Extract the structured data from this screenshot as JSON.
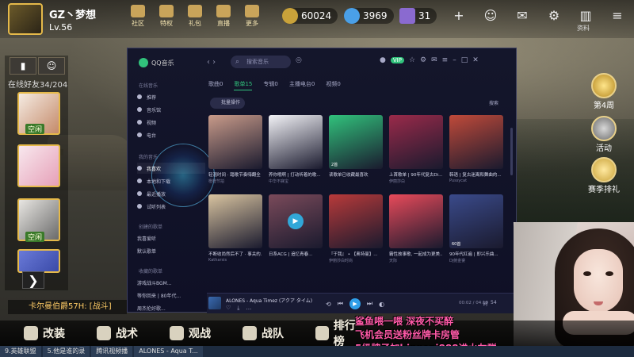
{
  "game": {
    "player_name": "GZ丶梦想",
    "player_level": "Lv.56",
    "top_nav": [
      {
        "label": "社区",
        "icon": "home-icon"
      },
      {
        "label": "特权",
        "icon": "crown-icon"
      },
      {
        "label": "礼包",
        "icon": "gift-icon"
      },
      {
        "label": "直播",
        "icon": "play-icon"
      },
      {
        "label": "更多",
        "icon": "grid-icon"
      }
    ],
    "currency": {
      "gold": "60024",
      "diamond": "3969",
      "card": "31"
    },
    "top_right_label": "资料",
    "friends": {
      "online_count": "在线好友34/204",
      "status_label": "空闲",
      "status_label_3": "空闲"
    },
    "chat_line": "卡尔曼伯爵57H: [战斗]",
    "bottom_menu": [
      {
        "label": "改装",
        "icon": "wrench-icon"
      },
      {
        "label": "战术",
        "icon": "skull-icon"
      },
      {
        "label": "观战",
        "icon": "star-icon"
      },
      {
        "label": "战队",
        "icon": "team-icon"
      },
      {
        "label": "排行榜",
        "icon": "trophy-icon"
      }
    ],
    "events": [
      {
        "label": "第4周"
      },
      {
        "label": "活动"
      },
      {
        "label": "赛季排礼"
      }
    ]
  },
  "overlay_chat": [
    "鲨鱼喂一喂  深夜不买醉",
    "飞机会员送粉丝牌卡房管",
    "5级牌子加biggezi888进水友群"
  ],
  "taskbar": [
    {
      "label": "9.英雄联盟"
    },
    {
      "label": "5.他是谁的录"
    },
    {
      "label": "腾讯视频播"
    },
    {
      "label": "ALONES - Aqua T..."
    }
  ],
  "qq_music": {
    "app_name": "QQ音乐",
    "search_placeholder": "搜索音乐",
    "sidebar": {
      "sections": [
        "在线音乐",
        "我的音乐",
        "创建的歌单",
        "收藏的歌单"
      ],
      "online": [
        "推荐",
        "音乐馆",
        "视频",
        "电台"
      ],
      "mine": [
        "我喜欢",
        "本地和下载",
        "最近播放",
        "试听列表"
      ],
      "created": [
        "我喜爱听",
        "默认歌单"
      ],
      "collected": [
        "游戏战斗BGM...",
        "等你回来 | 80年代...",
        "周杰伦好歌..."
      ]
    },
    "tabs": [
      "歌曲0",
      "歌单15",
      "专辑0",
      "主播电台0",
      "视频0"
    ],
    "active_tab_index": 1,
    "batch_button": "批量操作",
    "search_button": "搜索",
    "cards": [
      {
        "title": "轻混时间 · 踏歌节奏嗨翻全",
        "sub": "橙橙节拍",
        "count": "",
        "color": "#c99b8a"
      },
      {
        "title": "养你哦啊 | 打动听着的歌...",
        "sub": "中华不寐宝",
        "count": "",
        "color": "#f3f3f7"
      },
      {
        "title": "读歌单已收藏最喜欢",
        "sub": "",
        "count": "2首",
        "color": "#31c27c"
      },
      {
        "title": "上首歌单 | 90年代复古Di...",
        "sub": "伊丽莎白",
        "count": "",
        "color": "#9a2a4a"
      },
      {
        "title": "韩语 | 复古迷离和舞曲的...",
        "sub": "Pussycat",
        "count": "",
        "color": "#c04a3a"
      },
      {
        "title": "不断收尚然后不了 · 事关的...",
        "sub": "Katharsis",
        "count": "",
        "color": "#d9c4a0"
      },
      {
        "title": "日系ACG | 追忆青春...",
        "sub": "",
        "count": "",
        "color": "#7a4a5a"
      },
      {
        "title": "『于我』 • 【奥特曼】...",
        "sub": "伊丽莎白时尚",
        "count": "",
        "color": "#b83a3a"
      },
      {
        "title": "霸性故事歌, 一起成为更美...",
        "sub": "天际",
        "count": "",
        "color": "#e84a5a"
      },
      {
        "title": "90年代红遍 | 即兴乐曲...",
        "sub": "Dj鲍金宴",
        "count": "60首",
        "color": "#3a4a8a"
      }
    ],
    "player": {
      "title": "ALONES - Aqua Timez (アクア タイム)",
      "time": "00:02 / 04:19",
      "quality": "54"
    }
  }
}
